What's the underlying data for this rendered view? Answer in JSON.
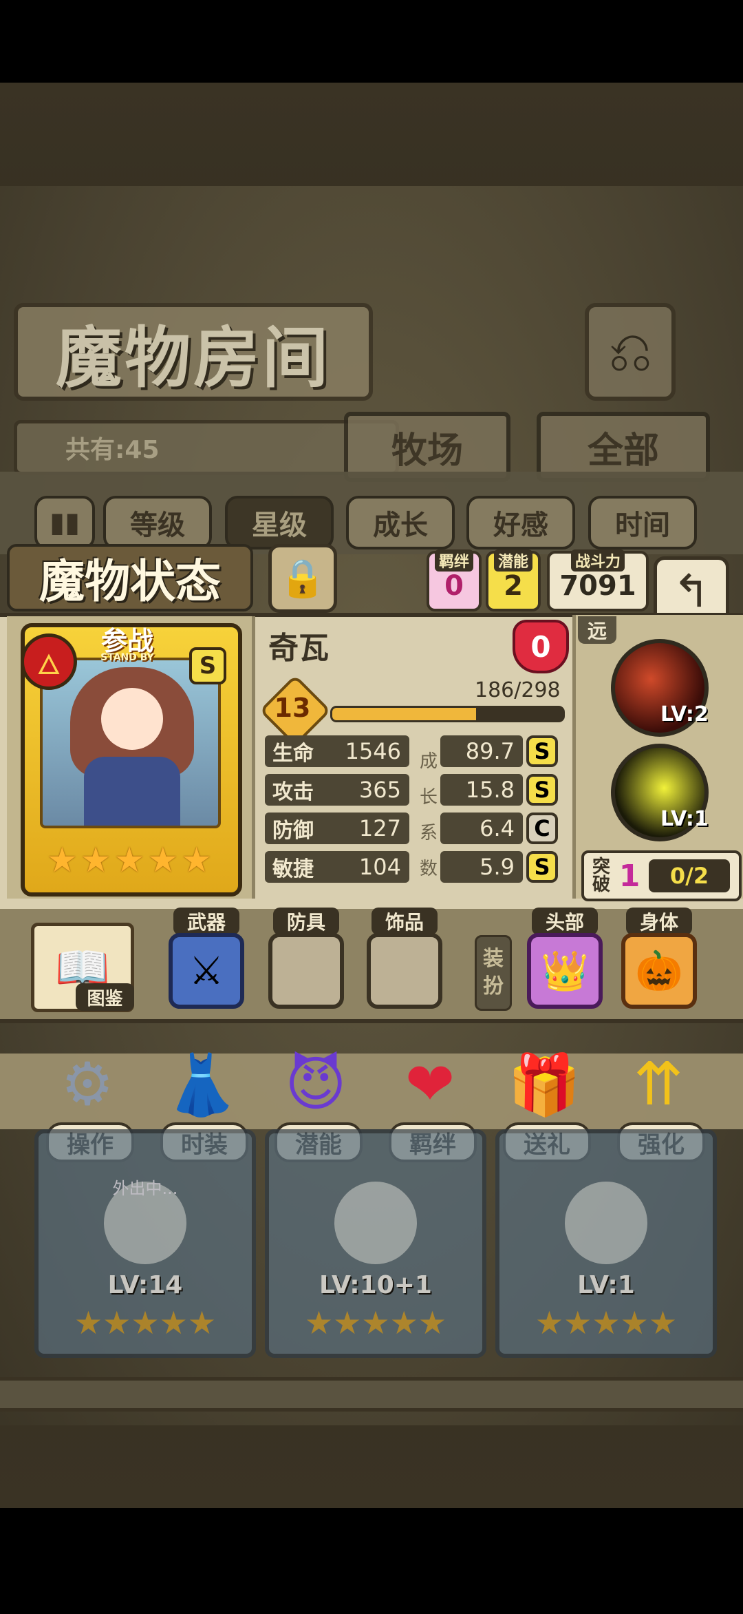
{
  "room": {
    "title": "魔物房间",
    "count": "共有:45",
    "tabs": [
      "牧场",
      "全部"
    ],
    "filters": [
      "等级",
      "星级",
      "成长",
      "好感",
      "时间"
    ],
    "selected_filter": "星级"
  },
  "status": {
    "title": "魔物状态",
    "bond_label": "羁绊",
    "bond_value": "0",
    "potential_label": "潜能",
    "potential_value": "2",
    "power_label": "战斗力",
    "power_value": "7091"
  },
  "monster": {
    "name": "奇瓦",
    "affection": "0",
    "standby_label": "参战",
    "standby_sub": "STAND BY",
    "rank": "S",
    "stars": 5,
    "level": "13",
    "exp_text": "186/298",
    "exp_fraction": 0.624,
    "stats": [
      {
        "name": "生命",
        "value": "1546",
        "growth": "89.7",
        "grade": "S"
      },
      {
        "name": "攻击",
        "value": "365",
        "growth": "15.8",
        "grade": "S"
      },
      {
        "name": "防御",
        "value": "127",
        "growth": "6.4",
        "grade": "C"
      },
      {
        "name": "敏捷",
        "value": "104",
        "growth": "5.9",
        "grade": "S"
      }
    ],
    "growth_label": [
      "成",
      "长",
      "系",
      "数"
    ],
    "range": "远",
    "skills": [
      {
        "level": "LV:2",
        "icon": "dark-claw-icon"
      },
      {
        "level": "LV:1",
        "icon": "yellow-blast-icon"
      }
    ],
    "breakthrough_label": "突破",
    "breakthrough_value": "1",
    "breakthrough_progress": "0/2"
  },
  "equipment": {
    "book_label": "图鉴",
    "slots": [
      {
        "label": "武器",
        "icon": "mace-icon"
      },
      {
        "label": "防具",
        "icon": ""
      },
      {
        "label": "饰品",
        "icon": ""
      }
    ],
    "dress_label": [
      "装",
      "扮"
    ],
    "outfit": [
      {
        "label": "头部",
        "icon": "tiara-icon"
      },
      {
        "label": "身体",
        "icon": "pumpkin-icon"
      }
    ]
  },
  "actions": [
    "操作",
    "时装",
    "潜能",
    "羁绊",
    "送礼",
    "强化"
  ],
  "list": [
    {
      "level": "LV:14",
      "status": "外出中..."
    },
    {
      "level": "LV:10+1",
      "status": ""
    },
    {
      "level": "LV:1",
      "status": ""
    }
  ],
  "colors": {
    "gold": "#f0b73b",
    "panel": "#d9cfb0",
    "dark": "#3a3223",
    "grade_s": "#f5de4a",
    "grade_c": "#d8d0bb"
  }
}
